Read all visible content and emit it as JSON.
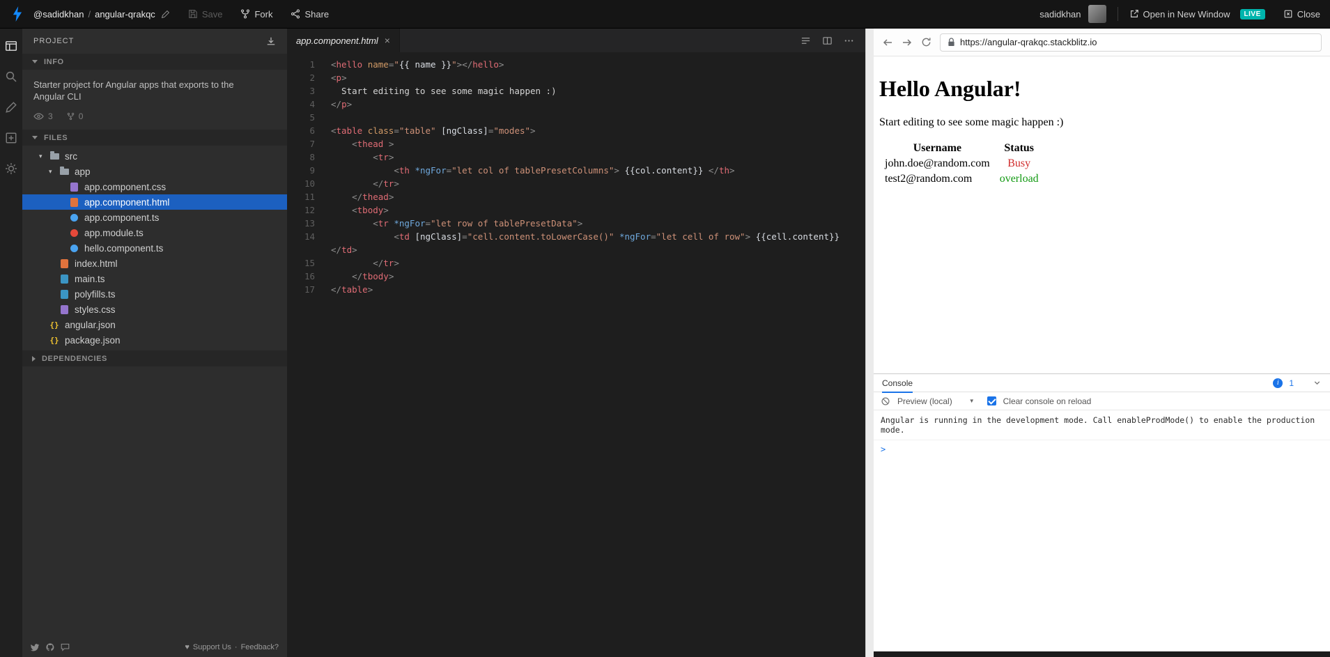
{
  "colors": {
    "accent_blue": "#1389fd",
    "selection_blue": "#1c60c0",
    "live_badge_teal": "#00b5ad",
    "console_accent": "#1a73e8",
    "status_busy_red": "#d02b2b",
    "status_overload_green": "#119911"
  },
  "icons": {
    "close_tab": "×",
    "heart": "♥",
    "caret_down": "▼",
    "folder_arrow": "▾"
  },
  "topbar": {
    "user_handle": "@sadidkhan",
    "separator": "/",
    "project_name": "angular-qrakqc",
    "save_label": "Save",
    "fork_label": "Fork",
    "share_label": "Share",
    "username": "sadidkhan",
    "open_new_window_label": "Open in New Window",
    "live_badge": "LIVE",
    "close_label": "Close"
  },
  "sidebar": {
    "project_header": "PROJECT",
    "info_header": "INFO",
    "files_header": "FILES",
    "dependencies_header": "DEPENDENCIES",
    "info_text": "Starter project for Angular apps that exports to the Angular CLI",
    "stats": {
      "views": "3",
      "forks": "0"
    },
    "files": [
      {
        "label": "src",
        "icon": "folder",
        "level": 0,
        "folder": true
      },
      {
        "label": "app",
        "icon": "folder",
        "level": 1,
        "folder": true
      },
      {
        "label": "app.component.css",
        "icon": "css",
        "level": 2
      },
      {
        "label": "app.component.html",
        "icon": "html",
        "level": 2,
        "selected": true
      },
      {
        "label": "app.component.ts",
        "icon": "component",
        "level": 2
      },
      {
        "label": "app.module.ts",
        "icon": "module",
        "level": 2
      },
      {
        "label": "hello.component.ts",
        "icon": "component",
        "level": 2
      },
      {
        "label": "index.html",
        "icon": "html",
        "level": 1
      },
      {
        "label": "main.ts",
        "icon": "ts",
        "level": 1
      },
      {
        "label": "polyfills.ts",
        "icon": "ts",
        "level": 1
      },
      {
        "label": "styles.css",
        "icon": "css",
        "level": 1
      },
      {
        "label": "angular.json",
        "icon": "json",
        "level": 0
      },
      {
        "label": "package.json",
        "icon": "json",
        "level": 0
      }
    ],
    "footer": {
      "support": "Support Us",
      "separator": "·",
      "feedback": "Feedback?"
    }
  },
  "editor": {
    "tab_label": "app.component.html",
    "lines": [
      {
        "num": "1",
        "tokens": [
          [
            "p",
            "<"
          ],
          [
            "t",
            "hello"
          ],
          [
            "x",
            " "
          ],
          [
            "a",
            "name"
          ],
          [
            "p",
            "="
          ],
          [
            "s",
            "\""
          ],
          [
            "e",
            "{{ name }}"
          ],
          [
            "s",
            "\""
          ],
          [
            "p",
            "></"
          ],
          [
            "t",
            "hello"
          ],
          [
            "p",
            ">"
          ]
        ]
      },
      {
        "num": "2",
        "tokens": [
          [
            "p",
            "<"
          ],
          [
            "t",
            "p"
          ],
          [
            "p",
            ">"
          ]
        ]
      },
      {
        "num": "3",
        "tokens": [
          [
            "x",
            "  Start editing to see some magic happen :)"
          ]
        ]
      },
      {
        "num": "4",
        "tokens": [
          [
            "p",
            "</"
          ],
          [
            "t",
            "p"
          ],
          [
            "p",
            ">"
          ]
        ]
      },
      {
        "num": "5",
        "tokens": []
      },
      {
        "num": "6",
        "tokens": [
          [
            "p",
            "<"
          ],
          [
            "t",
            "table"
          ],
          [
            "x",
            " "
          ],
          [
            "a",
            "class"
          ],
          [
            "p",
            "="
          ],
          [
            "s",
            "\"table\""
          ],
          [
            "x",
            " "
          ],
          [
            "e",
            "[ngClass]"
          ],
          [
            "p",
            "="
          ],
          [
            "s",
            "\"modes\""
          ],
          [
            "p",
            ">"
          ]
        ]
      },
      {
        "num": "7",
        "tokens": [
          [
            "x",
            "    "
          ],
          [
            "p",
            "<"
          ],
          [
            "t",
            "thead"
          ],
          [
            "x",
            " "
          ],
          [
            "p",
            ">"
          ]
        ]
      },
      {
        "num": "8",
        "tokens": [
          [
            "x",
            "        "
          ],
          [
            "p",
            "<"
          ],
          [
            "t",
            "tr"
          ],
          [
            "p",
            ">"
          ]
        ]
      },
      {
        "num": "9",
        "tokens": [
          [
            "x",
            "            "
          ],
          [
            "p",
            "<"
          ],
          [
            "t",
            "th"
          ],
          [
            "x",
            " "
          ],
          [
            "ng",
            "*ngFor"
          ],
          [
            "p",
            "="
          ],
          [
            "s",
            "\"let col of tablePresetColumns\""
          ],
          [
            "p",
            ">"
          ],
          [
            "x",
            " "
          ],
          [
            "e",
            "{{col.content}}"
          ],
          [
            "x",
            " "
          ],
          [
            "p",
            "</"
          ],
          [
            "t",
            "th"
          ],
          [
            "p",
            ">"
          ]
        ]
      },
      {
        "num": "10",
        "tokens": [
          [
            "x",
            "        "
          ],
          [
            "p",
            "</"
          ],
          [
            "t",
            "tr"
          ],
          [
            "p",
            ">"
          ]
        ]
      },
      {
        "num": "11",
        "tokens": [
          [
            "x",
            "    "
          ],
          [
            "p",
            "</"
          ],
          [
            "t",
            "thead"
          ],
          [
            "p",
            ">"
          ]
        ]
      },
      {
        "num": "12",
        "tokens": [
          [
            "x",
            "    "
          ],
          [
            "p",
            "<"
          ],
          [
            "t",
            "tbody"
          ],
          [
            "p",
            ">"
          ]
        ]
      },
      {
        "num": "13",
        "tokens": [
          [
            "x",
            "        "
          ],
          [
            "p",
            "<"
          ],
          [
            "t",
            "tr"
          ],
          [
            "x",
            " "
          ],
          [
            "ng",
            "*ngFor"
          ],
          [
            "p",
            "="
          ],
          [
            "s",
            "\"let row of tablePresetData\""
          ],
          [
            "p",
            ">"
          ]
        ]
      },
      {
        "num": "14",
        "tokens": [
          [
            "x",
            "            "
          ],
          [
            "p",
            "<"
          ],
          [
            "t",
            "td"
          ],
          [
            "x",
            " "
          ],
          [
            "e",
            "[ngClass]"
          ],
          [
            "p",
            "="
          ],
          [
            "s",
            "\"cell.content.toLowerCase()\""
          ],
          [
            "x",
            " "
          ],
          [
            "ng",
            "*ngFor"
          ],
          [
            "p",
            "="
          ],
          [
            "s",
            "\"let cell of row\""
          ],
          [
            "p",
            ">"
          ],
          [
            "x",
            " "
          ],
          [
            "e",
            "{{cell.content}}"
          ]
        ]
      },
      {
        "num": "",
        "tokens": [
          [
            "p",
            "</"
          ],
          [
            "t",
            "td"
          ],
          [
            "p",
            ">"
          ]
        ]
      },
      {
        "num": "15",
        "tokens": [
          [
            "x",
            "        "
          ],
          [
            "p",
            "</"
          ],
          [
            "t",
            "tr"
          ],
          [
            "p",
            ">"
          ]
        ]
      },
      {
        "num": "16",
        "tokens": [
          [
            "x",
            "    "
          ],
          [
            "p",
            "</"
          ],
          [
            "t",
            "tbody"
          ],
          [
            "p",
            ">"
          ]
        ]
      },
      {
        "num": "17",
        "tokens": [
          [
            "p",
            "</"
          ],
          [
            "t",
            "table"
          ],
          [
            "p",
            ">"
          ]
        ]
      }
    ]
  },
  "preview": {
    "url": "https://angular-qrakqc.stackblitz.io",
    "heading": "Hello Angular!",
    "paragraph": "Start editing to see some magic happen :)",
    "table": {
      "headers": [
        "Username",
        "Status"
      ],
      "rows": [
        {
          "username": "john.doe@random.com",
          "status": "Busy",
          "status_color": "#d02b2b"
        },
        {
          "username": "test2@random.com",
          "status": "overload",
          "status_color": "#119911"
        }
      ]
    },
    "console": {
      "title": "Console",
      "badge_count": "1",
      "context_label": "Preview (local)",
      "checkbox_label": "Clear console on reload",
      "log": "Angular is running in the development mode. Call enableProdMode() to enable the production mode.",
      "prompt": ">"
    }
  }
}
